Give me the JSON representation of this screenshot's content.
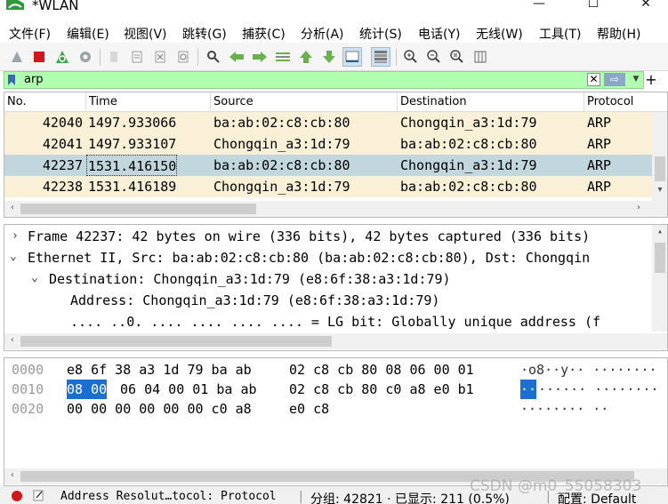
{
  "window": {
    "title": "*WLAN",
    "minimize": "—",
    "maximize": "☐",
    "close": "✕"
  },
  "menu": [
    "文件(F)",
    "编辑(E)",
    "视图(V)",
    "跳转(G)",
    "捕获(C)",
    "分析(A)",
    "统计(S)",
    "电话(Y)",
    "无线(W)",
    "工具(T)",
    "帮助(H)"
  ],
  "filter": {
    "value": "arp",
    "clear": "✕",
    "apply": "⇨",
    "dropdown": "▼",
    "add": "+"
  },
  "packet_list": {
    "columns": [
      "No.",
      "Time",
      "Source",
      "Destination",
      "Protocol"
    ],
    "rows": [
      {
        "no": "42040",
        "time": "1497.933066",
        "source": "ba:ab:02:c8:cb:80",
        "destination": "Chongqin_a3:1d:79",
        "protocol": "ARP"
      },
      {
        "no": "42041",
        "time": "1497.933107",
        "source": "Chongqin_a3:1d:79",
        "destination": "ba:ab:02:c8:cb:80",
        "protocol": "ARP"
      },
      {
        "no": "42237",
        "time": "1531.416150",
        "source": "ba:ab:02:c8:cb:80",
        "destination": "Chongqin_a3:1d:79",
        "protocol": "ARP"
      },
      {
        "no": "42238",
        "time": "1531.416189",
        "source": "Chongqin_a3:1d:79",
        "destination": "ba:ab:02:c8:cb:80",
        "protocol": "ARP"
      }
    ]
  },
  "details": [
    "Frame 42237: 42 bytes on wire (336 bits), 42 bytes captured (336 bits)",
    "Ethernet II, Src: ba:ab:02:c8:cb:80 (ba:ab:02:c8:cb:80), Dst: Chongqin",
    "Destination: Chongqin_a3:1d:79 (e8:6f:38:a3:1d:79)",
    "Address: Chongqin_a3:1d:79 (e8:6f:38:a3:1d:79)",
    ".... ..0. .... .... .... .... = LG bit: Globally unique address (f"
  ],
  "hex": {
    "rows": [
      {
        "offset": "0000",
        "bytes_a": "e8 6f 38 a3 1d 79 ba ab",
        "bytes_b": "02 c8 cb 80 08 06 00 01",
        "ascii": "·o8··y·· ········"
      },
      {
        "offset": "0010",
        "hl": "08 00",
        "bytes_a": "06 04 00 01 ba ab",
        "bytes_b": "02 c8 cb 80 c0 a8 e0 b1",
        "ascii_hl": "··",
        "ascii": "······ ········"
      },
      {
        "offset": "0020",
        "bytes_a": "00 00 00 00 00 00 c0 a8",
        "bytes_b": "e0 c8",
        "ascii": "········ ··"
      }
    ]
  },
  "status": {
    "field": "Address Resolut…tocol: Protocol",
    "packets": "分组: 42821 · 已显示: 211 (0.5%)",
    "profile": "配置: Default"
  },
  "watermark": "CSDN @m0_55058303",
  "colors": {
    "filter_bg": "#afffaf",
    "row_bg": "#faf0d7",
    "row_selected": "#c2d6de",
    "hex_highlight": "#1b6fd0"
  }
}
